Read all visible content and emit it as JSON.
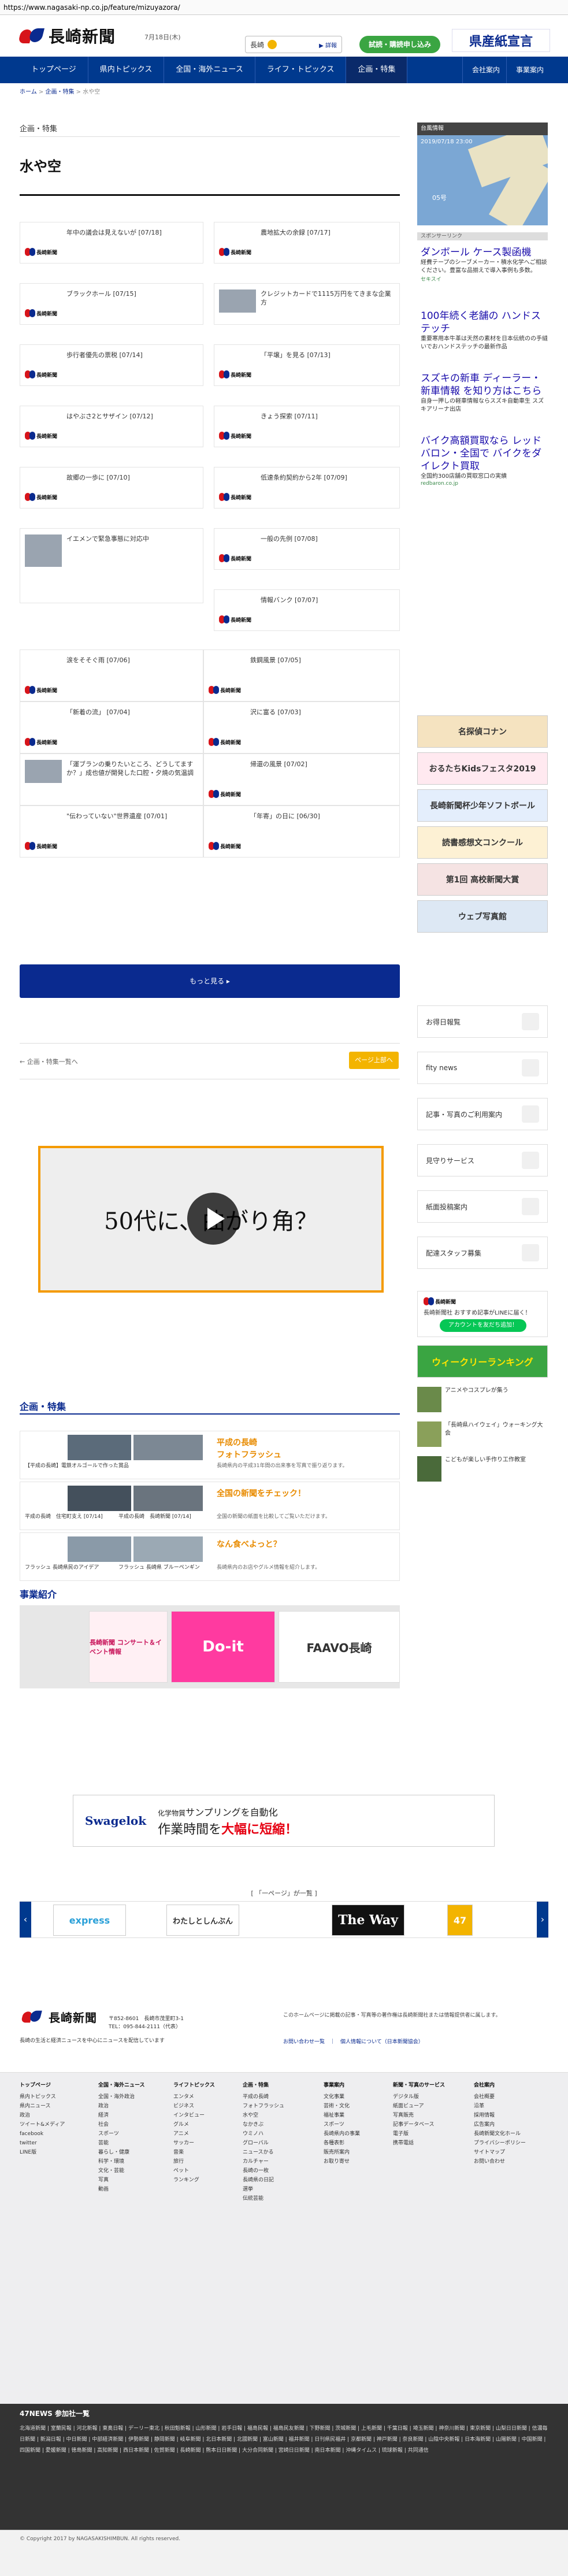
{
  "url": "https://www.nagasaki-np.co.jp/feature/mizuyazora/",
  "header": {
    "logo": "長崎新聞",
    "date": "7月18日(木)",
    "weather_city": "長崎",
    "weather_link": "▶ 詳報",
    "subscribe": "試読・購読申し込み",
    "ad_head": "県産紙宣言"
  },
  "nav": {
    "items": [
      "トップページ",
      "県内トピックス",
      "全国・海外ニュース",
      "ライフ・トピックス",
      "企画・特集"
    ],
    "right": [
      "会社案内",
      "事業案内"
    ]
  },
  "breadcrumb": [
    "ホーム",
    "企画・特集",
    "水や空"
  ],
  "category": "企画・特集",
  "title": "水や空",
  "articles": [
    {
      "t": "年中の議会は見えないが [07/18]"
    },
    {
      "t": "農地拡大の余録 [07/17]"
    },
    {
      "t": "ブラックホール [07/15]"
    },
    {
      "t": "クレジットカードで1115万円をてきまな企業方"
    },
    {
      "t": "歩行者優先の票税 [07/14]"
    },
    {
      "t": "「平壌」を見る [07/13]"
    },
    {
      "t": "はやぶさ2とサザイン [07/12]"
    },
    {
      "t": "きょう探索 [07/11]"
    },
    {
      "t": "故郷の一歩に [07/10]"
    },
    {
      "t": "低速条約契約から2年 [07/09]"
    },
    {
      "t": "イエメンで緊急事態に対応中"
    },
    {
      "t": "一般の先例 [07/08]"
    },
    {
      "t": "情報バンク [07/07]"
    },
    {
      "t": "涙をそそぐ雨 [07/06]"
    },
    {
      "t": "鉄鋼風景 [07/05]"
    },
    {
      "t": "「新着の流」 [07/04]"
    },
    {
      "t": "沢に富る [07/03]"
    },
    {
      "t": "「運ブランの乗りたいところ、どうしてますか？」成也値が開発した口腔・夕焼の気温調"
    },
    {
      "t": "帰還の風景 [07/02]"
    },
    {
      "t": "\"伝わっていない\"世界遺産 [07/01]"
    },
    {
      "t": "「年寄」の日に [06/30]"
    }
  ],
  "more_label": "もっと見る ▸",
  "back_label": "← 企画・特集一覧へ",
  "pagetop_label": "ページ上部へ",
  "video_text": "50代に、曲がり角？",
  "features": {
    "heading": "企画・特集",
    "rows": [
      {
        "caps": [
          "【平成の長崎】電鉄オルゴールで作った賞品",
          "平成の長崎フォトフラッシュ"
        ],
        "t1": "平成の長崎",
        "t2": "フォトフラッシュ",
        "d": "長崎県内の平成31年間の出来事を写真で振り返ります。"
      },
      {
        "caps": [
          "平成の長崎　住宅町支え [07/14]",
          "平成の長崎　長崎新聞 [07/14]"
        ],
        "t1": "全国の新聞をチェック！",
        "t2": "",
        "d": "全国の新聞の紙面を比較してご覧いただけます。"
      },
      {
        "caps": [
          "フラッシュ 長崎県民のアイデア",
          "フラッシュ 長崎県 ブルーペンギン"
        ],
        "t1": "なん食べよっと？",
        "t2": "",
        "d": "長崎県内のお店やグルメ情報を紹介します。"
      }
    ]
  },
  "business": {
    "heading": "事業紹介",
    "items": [
      "長崎新聞 コンサート＆イベント情報",
      "Do-it",
      "FAAVO長崎"
    ]
  },
  "ad_wide": {
    "brand": "Swagelok",
    "msg1": "化学物質",
    "msg2": "サンプリングを自動化",
    "msg3": "作業時間を",
    "msg4": "大幅に短縮！"
  },
  "carousel": {
    "label": "[ 「一ページ」が一覧 ]",
    "items": [
      "express",
      "わたしとしんぶん",
      "The Way",
      "47"
    ]
  },
  "footer": {
    "logo": "長崎新聞",
    "addr1": "〒852-8601　長崎市茂里町3-1",
    "addr2": "TEL：095-844-2111（代表）",
    "addr3": "長崎の生活と経済ニュースを中心にニュースを配信しています",
    "note": "このホームページに掲載の記事・写真等の著作権は長崎新聞社または情報提供者に属します。",
    "links": [
      "お問い合わせ一覧",
      "個人情報について（日本新聞協会）"
    ],
    "cols": [
      {
        "h": "トップページ",
        "items": [
          "県内トピックス",
          "県内ニュース",
          "政治",
          "ツイート&メディア",
          "facebook",
          "twitter",
          "LINE版"
        ]
      },
      {
        "h": "全国・海外ニュース",
        "items": [
          "全国・海外政治",
          "政治",
          "経済",
          "社会",
          "スポーツ",
          "芸能",
          "暮らし・健康",
          "科学・環境",
          "文化・芸能",
          "写真",
          "動画"
        ]
      },
      {
        "h": "ライフトピックス",
        "items": [
          "エンタメ",
          "ビジネス",
          "インタビュー",
          "グルメ",
          "アニメ",
          "サッカー",
          "音楽",
          "旅行",
          "ペット",
          "ランキング"
        ]
      },
      {
        "h": "企画・特集",
        "items": [
          "平成の長崎",
          "フォトフラッシュ",
          "水や空",
          "なかきぶ",
          "ウミノハ",
          "グローバル",
          "ニュースかる",
          "カルチャー",
          "長崎の一枚",
          "長崎県の日記",
          "選挙",
          "伝統芸能"
        ]
      },
      {
        "h": "事業案内",
        "items": [
          "文化事業",
          "芸術・文化",
          "福祉事業",
          "スポーツ",
          "長崎県内の事業",
          "各種表彰",
          "販売所案内",
          "お取り寄せ"
        ]
      },
      {
        "h": "新聞・写真のサービス",
        "items": [
          "デジタル版",
          "紙面ビューア",
          "写真販売",
          "記事データベース",
          "電子版",
          "携帯電話"
        ]
      },
      {
        "h": "会社案内",
        "items": [
          "会社概要",
          "沿革",
          "採用情報",
          "広告案内",
          "長崎新聞文化ホール",
          "プライバシーポリシー",
          "サイトマップ",
          "お問い合わせ"
        ]
      }
    ]
  },
  "n47": {
    "heading": "47NEWS 参加社一覧",
    "text": "北海道新聞 | 室蘭民報 | 河北新報 | 東奥日報 | デーリー東北 | 秋田魁新報 | 山形新聞 | 岩手日報 | 福島民報 | 福島民友新聞 | 下野新聞 | 茨城新聞 | 上毛新聞 | 千葉日報 | 埼玉新聞 | 神奈川新聞 | 東京新聞 | 山梨日日新聞 | 信濃毎日新聞 | 新潟日報 | 中日新聞 | 中部経済新聞 | 伊勢新聞 | 静岡新聞 | 岐阜新聞 | 北日本新聞 | 北國新聞 | 富山新聞 | 福井新聞 | 日刊県民福井 | 京都新聞 | 神戸新聞 | 奈良新聞 | 山陰中央新報 | 日本海新聞 | 山陽新聞 | 中国新聞 | 四国新聞 | 愛媛新聞 | 徳島新聞 | 高知新聞 | 西日本新聞 | 佐賀新聞 | 長崎新聞 | 熊本日日新聞 | 大分合同新聞 | 宮崎日日新聞 | 南日本新聞 | 沖縄タイムス | 琉球新報 | 共同通信"
  },
  "copyright": "© Copyright 2017 by NAGASAKISHIMBUN. All rights reserved.",
  "sidebar": {
    "map_head": "台風情報",
    "map_time": "2019/07/18 23:00",
    "map_no": "05号",
    "sponsor": "スポンサーリンク",
    "ads": [
      {
        "h": "ダンボール ケース製函機",
        "p": "経費テープのシーブメーカー・積水化学へご相談ください。豊富な品揃えで導入事例も多数。",
        "u": "セキスイ"
      },
      {
        "h": "100年続く老舗の ハンドステッチ",
        "p": "重要寒用本牛革は天然の素材を日本伝統のの手縫いでおハンドステッチの最新作品",
        "u": ""
      },
      {
        "h": "スズキの新車 ディーラー・新車情報 を知り方はこちら",
        "p": "自身一押しの軽車情報ならスズキ自動車生 スズキアリーナ出店",
        "u": ""
      },
      {
        "h": "バイク高額買取なら レッドバロン・全国で バイクをダイレクト買取",
        "p": "全国約300店舗の買取窓口の実績",
        "u": "redbaron.co.jp"
      }
    ],
    "banners": [
      "名探偵コナン",
      "おるたちKidsフェスタ2019",
      "長崎新聞杯少年ソフトボール",
      "読書感想文コンクール",
      "第1回 高校新聞大賞",
      "ウェブ写真館"
    ],
    "boxes": [
      "お得日報覧",
      "fity news",
      "記事・写真のご利用案内",
      "見守りサービス",
      "紙面投稿案内",
      "配達スタッフ募集"
    ],
    "line_title": "長崎新聞社 おすすめ記事がLINEに届く！",
    "line_btn": "アカウントを友だち追加！",
    "week_label": "ウィークリーランキング",
    "week_items": [
      "アニメやコスプレが集う",
      "「長崎県ハイウェイ」ウォーキング大会",
      "こどもが楽しい手作り工作教室"
    ]
  }
}
